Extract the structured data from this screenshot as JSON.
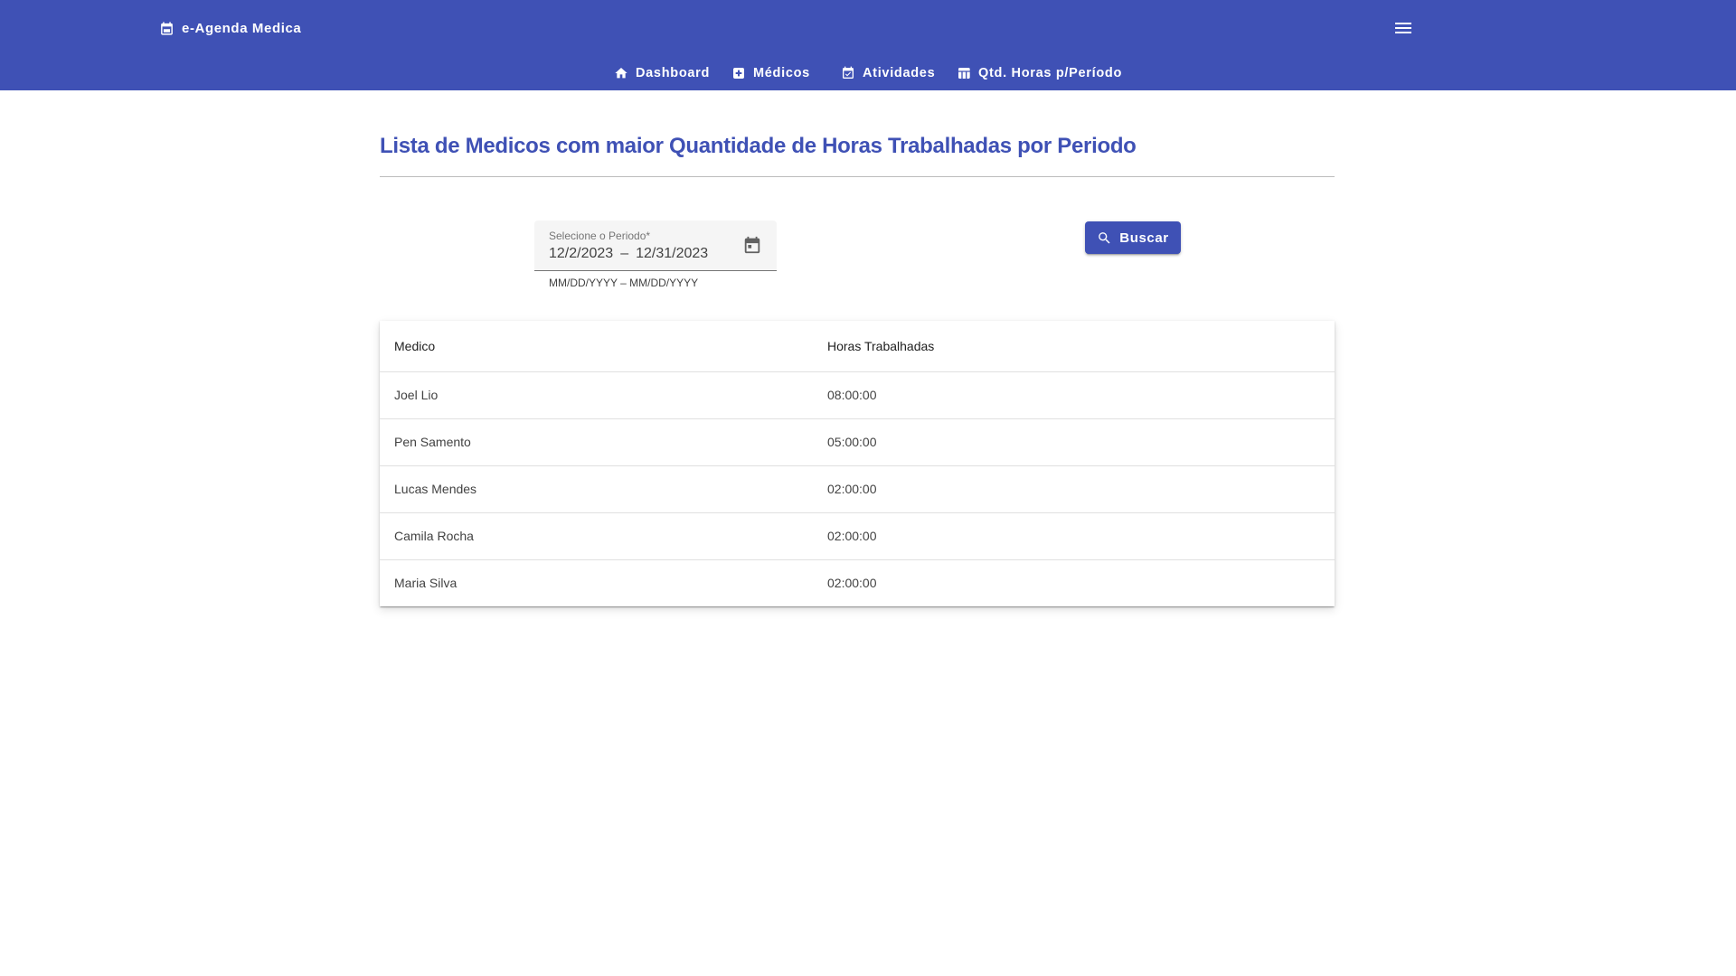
{
  "app": {
    "title": "e-Agenda Medica"
  },
  "nav": {
    "items": [
      {
        "label": "Dashboard",
        "icon": "home-icon"
      },
      {
        "label": "Médicos",
        "icon": "medical-services-icon"
      },
      {
        "label": "Atividades",
        "icon": "event-available-icon"
      },
      {
        "label": "Qtd. Horas p/Período",
        "icon": "table-chart-icon"
      }
    ]
  },
  "main": {
    "title": "Lista de Medicos com maior Quantidade de Horas Trabalhadas por Periodo",
    "period_field": {
      "label": "Selecione o Periodo*",
      "start": "12/2/2023",
      "separator": "–",
      "end": "12/31/2023",
      "hint": "MM/DD/YYYY – MM/DD/YYYY"
    },
    "search_button": {
      "label": "Buscar"
    },
    "table": {
      "columns": [
        "Medico",
        "Horas Trabalhadas"
      ],
      "rows": [
        {
          "medico": "Joel Lio",
          "horas": "08:00:00"
        },
        {
          "medico": "Pen Samento",
          "horas": "05:00:00"
        },
        {
          "medico": "Lucas Mendes",
          "horas": "02:00:00"
        },
        {
          "medico": "Camila Rocha",
          "horas": "02:00:00"
        },
        {
          "medico": "Maria Silva",
          "horas": "02:00:00"
        }
      ]
    }
  },
  "colors": {
    "primary": "#3f51b5",
    "background": "#ffffff",
    "field_fill": "#f5f5f5"
  }
}
